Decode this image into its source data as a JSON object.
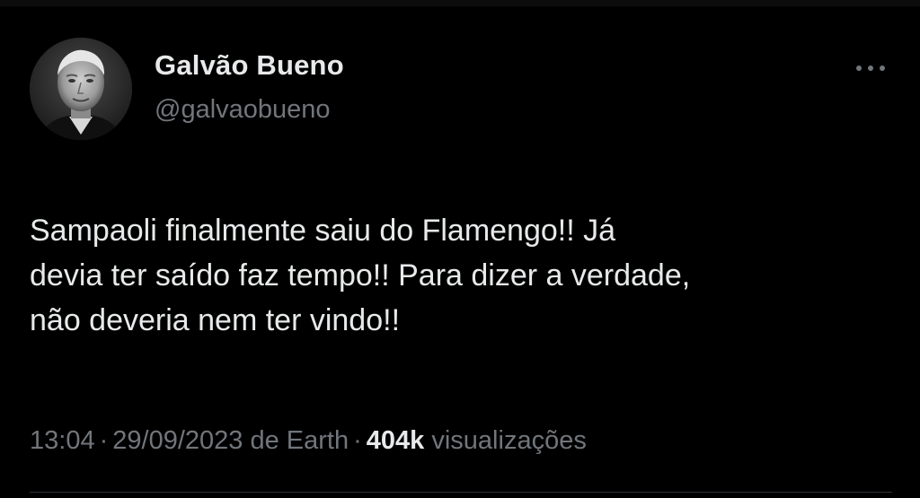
{
  "author": {
    "display_name": "Galvão Bueno",
    "handle": "@galvaobueno",
    "avatar_icon": "profile-photo"
  },
  "tweet": {
    "text": "Sampaoli finalmente saiu do Flamengo!! Já\ndevia ter saído faz tempo!! Para dizer a verdade,\nnão deveria nem ter vindo!!"
  },
  "meta": {
    "time": "13:04",
    "separator": "·",
    "date": "29/09/2023",
    "source": "de Earth",
    "views_count": "404k",
    "views_label": "visualizações"
  },
  "actions": {
    "more_icon": "more-horizontal-icon"
  },
  "colors": {
    "background": "#000000",
    "primary_text": "#e7e9ea",
    "secondary_text": "#71767b",
    "divider": "#2f3336"
  }
}
